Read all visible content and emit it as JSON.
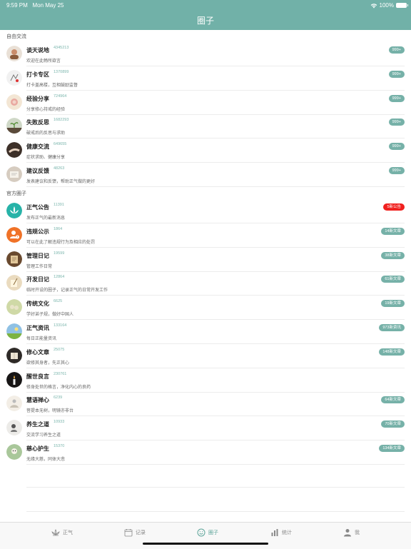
{
  "status_bar": {
    "time": "9:59 PM",
    "date": "Mon May 25",
    "battery": "100%"
  },
  "nav": {
    "title": "圈子"
  },
  "sections": [
    {
      "title": "自由交流",
      "items": [
        {
          "name": "谈天说地",
          "count": "4345213",
          "desc": "欢迎在此畅所欲言",
          "badge": "999+",
          "badge_color": "teal",
          "icon": "chat-avatar-icon"
        },
        {
          "name": "打卡专区",
          "count": "1370899",
          "desc": "打卡盖高楼，互相鼓励监督",
          "badge": "999+",
          "badge_color": "teal",
          "icon": "checkin-avatar-icon"
        },
        {
          "name": "经验分享",
          "count": "724964",
          "desc": "分享修心持戒的经验",
          "badge": "999+",
          "badge_color": "teal",
          "icon": "experience-avatar-icon"
        },
        {
          "name": "失败反思",
          "count": "1682293",
          "desc": "破戒后的反思与求助",
          "badge": "999+",
          "badge_color": "teal",
          "icon": "sprout-avatar-icon"
        },
        {
          "name": "健康交流",
          "count": "649655",
          "desc": "症状求助、健康分享",
          "badge": "999+",
          "badge_color": "teal",
          "icon": "health-avatar-icon"
        },
        {
          "name": "建议反馈",
          "count": "48263",
          "desc": "发表建议和反馈，帮助正气做的更好",
          "badge": "999+",
          "badge_color": "teal",
          "icon": "feedback-avatar-icon"
        }
      ]
    },
    {
      "title": "官方圈子",
      "items": [
        {
          "name": "正气公告",
          "count": "11391",
          "desc": "发布正气的最新消息",
          "badge": "5新公告",
          "badge_color": "red",
          "icon": "lotus-avatar-icon"
        },
        {
          "name": "违规公示",
          "count": "1864",
          "desc": "可以在此了解违规行为及相应的处罚",
          "badge": "14新文章",
          "badge_color": "teal",
          "icon": "user-warning-avatar-icon"
        },
        {
          "name": "管理日记",
          "count": "19599",
          "desc": "管理工作日常",
          "badge": "38新文章",
          "badge_color": "teal",
          "icon": "diary-avatar-icon"
        },
        {
          "name": "开发日记",
          "count": "12864",
          "desc": "临时开设的圈子，记录正气的日常开发工作",
          "badge": "61新文章",
          "badge_color": "teal",
          "icon": "dev-diary-avatar-icon"
        },
        {
          "name": "传统文化",
          "count": "6625",
          "desc": "学好弟子规，做好中国人",
          "badge": "19新文章",
          "badge_color": "teal",
          "icon": "culture-avatar-icon"
        },
        {
          "name": "正气资讯",
          "count": "133164",
          "desc": "每日正能量资讯",
          "badge": "973新资讯",
          "badge_color": "teal",
          "icon": "news-avatar-icon"
        },
        {
          "name": "修心文章",
          "count": "25075",
          "desc": "欲修其身者，先正其心",
          "badge": "148新文章",
          "badge_color": "teal",
          "icon": "article-avatar-icon"
        },
        {
          "name": "醒世良言",
          "count": "230761",
          "desc": "修身处世的格言，净化内心的良药",
          "badge": "",
          "badge_color": "teal",
          "icon": "candle-avatar-icon"
        },
        {
          "name": "慧语禅心",
          "count": "6239",
          "desc": "菩提本无树，明镜亦非台",
          "badge": "64新文章",
          "badge_color": "teal",
          "icon": "zen-avatar-icon"
        },
        {
          "name": "养生之道",
          "count": "10933",
          "desc": "交流学习养生之道",
          "badge": "70新文章",
          "badge_color": "teal",
          "icon": "wellness-avatar-icon"
        },
        {
          "name": "慈心护生",
          "count": "15370",
          "desc": "无缘大慈，同体大悲",
          "badge": "134新文章",
          "badge_color": "teal",
          "icon": "compassion-avatar-icon"
        }
      ]
    }
  ],
  "tabs": [
    {
      "label": "正气",
      "icon": "lotus-icon",
      "active": false
    },
    {
      "label": "记录",
      "icon": "calendar-icon",
      "active": false
    },
    {
      "label": "圈子",
      "icon": "smile-icon",
      "active": true
    },
    {
      "label": "统计",
      "icon": "bar-chart-icon",
      "active": false
    },
    {
      "label": "我",
      "icon": "person-icon",
      "active": false
    }
  ],
  "colors": {
    "primary": "#71b1a8",
    "badge": "#76b1a8",
    "badge_red": "#f0201e"
  }
}
